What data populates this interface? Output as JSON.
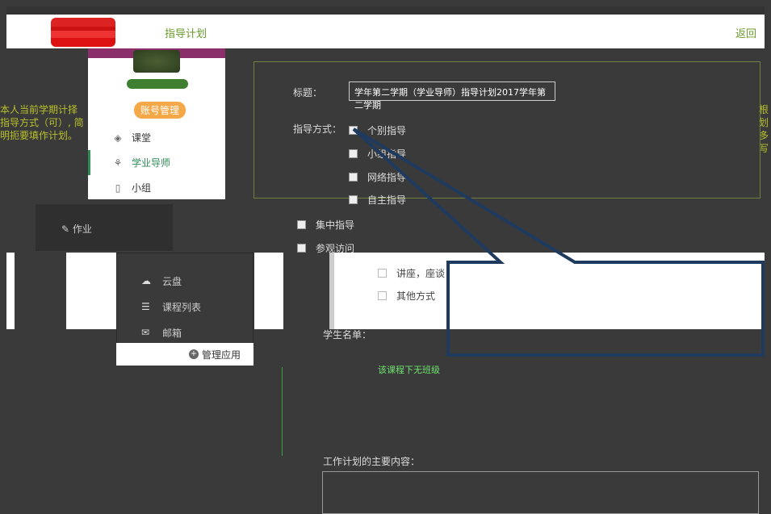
{
  "header": {
    "title": "指导计划",
    "back": "返回"
  },
  "left_note": "本人当前学期计择指导方式（可）, 简明扼要填作计划。",
  "right_note": "根划多写",
  "profile": {
    "account_button": "账号管理",
    "menu": [
      {
        "label": "课堂",
        "icon": "graduation-cap-icon"
      },
      {
        "label": "学业导师",
        "icon": "mentor-icon"
      },
      {
        "label": "小组",
        "icon": "book-icon"
      }
    ]
  },
  "popup1": {
    "item": "作业"
  },
  "popup2": {
    "items": [
      {
        "label": "云盘",
        "icon": "cloud-icon"
      },
      {
        "label": "课程列表",
        "icon": "list-icon"
      },
      {
        "label": "邮箱",
        "icon": "mail-icon"
      }
    ]
  },
  "manage_apps": "管理应用",
  "form": {
    "title_label": "标题：",
    "title_value": "学年第二学期（学业导师）指导计划2017学年第二学期",
    "method_label": "指导方式：",
    "methods": [
      "个别指导",
      "小组指导",
      "网络指导",
      "自主指导"
    ],
    "methods2": [
      "集中指导",
      "参观访问"
    ],
    "methods3": [
      "讲座，座谈",
      "其他方式"
    ],
    "students_label": "学生名单：",
    "no_class": "该课程下无班级",
    "plan_label": "工作计划的主要内容：",
    "plan_value": ""
  }
}
